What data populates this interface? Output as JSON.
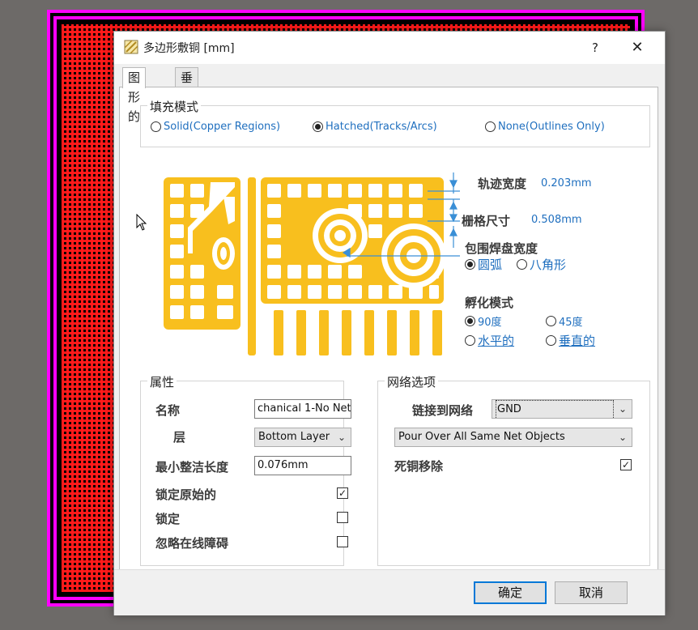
{
  "dialog": {
    "title": "多边形敷铜 [mm]",
    "help_label": "?",
    "close_label": "✕"
  },
  "tabs": [
    {
      "label": "图形的",
      "active": true
    },
    {
      "label": "垂直外框",
      "active": false
    }
  ],
  "fill_mode": {
    "title": "填充模式",
    "options": [
      {
        "label": "Solid(Copper Regions)",
        "selected": false
      },
      {
        "label": "Hatched(Tracks/Arcs)",
        "selected": true
      },
      {
        "label": "None(Outlines Only)",
        "selected": false
      }
    ]
  },
  "hatch": {
    "track_width_label": "轨迹宽度",
    "track_width_value": "0.203mm",
    "grid_size_label": "栅格尺寸",
    "grid_size_value": "0.508mm",
    "surround_pads_label": "包围焊盘宽度",
    "surround_options": [
      {
        "label": "圆弧",
        "selected": true
      },
      {
        "label": "八角形",
        "selected": false
      }
    ],
    "hatch_mode_label": "孵化模式",
    "hatch_options": [
      {
        "label": "90度",
        "selected": true
      },
      {
        "label": "45度",
        "selected": false
      },
      {
        "label": "水平的",
        "selected": false
      },
      {
        "label": "垂直的",
        "selected": false
      }
    ]
  },
  "properties": {
    "title": "属性",
    "name_label": "名称",
    "name_value": "chanical 1-No Net",
    "layer_label": "层",
    "layer_value": "Bottom Layer",
    "min_length_label": "最小整洁长度",
    "min_length_value": "0.076mm",
    "lock_primitives_label": "锁定原始的",
    "lock_primitives_checked": true,
    "locked_label": "锁定",
    "locked_checked": false,
    "ignore_obstacles_label": "忽略在线障碍",
    "ignore_obstacles_checked": false
  },
  "net_options": {
    "title": "网络选项",
    "connect_label": "链接到网络",
    "connect_value": "GND",
    "pour_value": "Pour Over All Same Net Objects",
    "remove_dead_label": "死铜移除",
    "remove_dead_checked": true
  },
  "footer": {
    "ok_label": "确定",
    "cancel_label": "取消"
  },
  "colors": {
    "pcb_magenta": "#ff00ff",
    "pcb_red": "#ff1a1a",
    "copper": "#f8bf1e",
    "accent_blue": "#1f6fbf",
    "arrow_blue": "#3a8fd6"
  }
}
